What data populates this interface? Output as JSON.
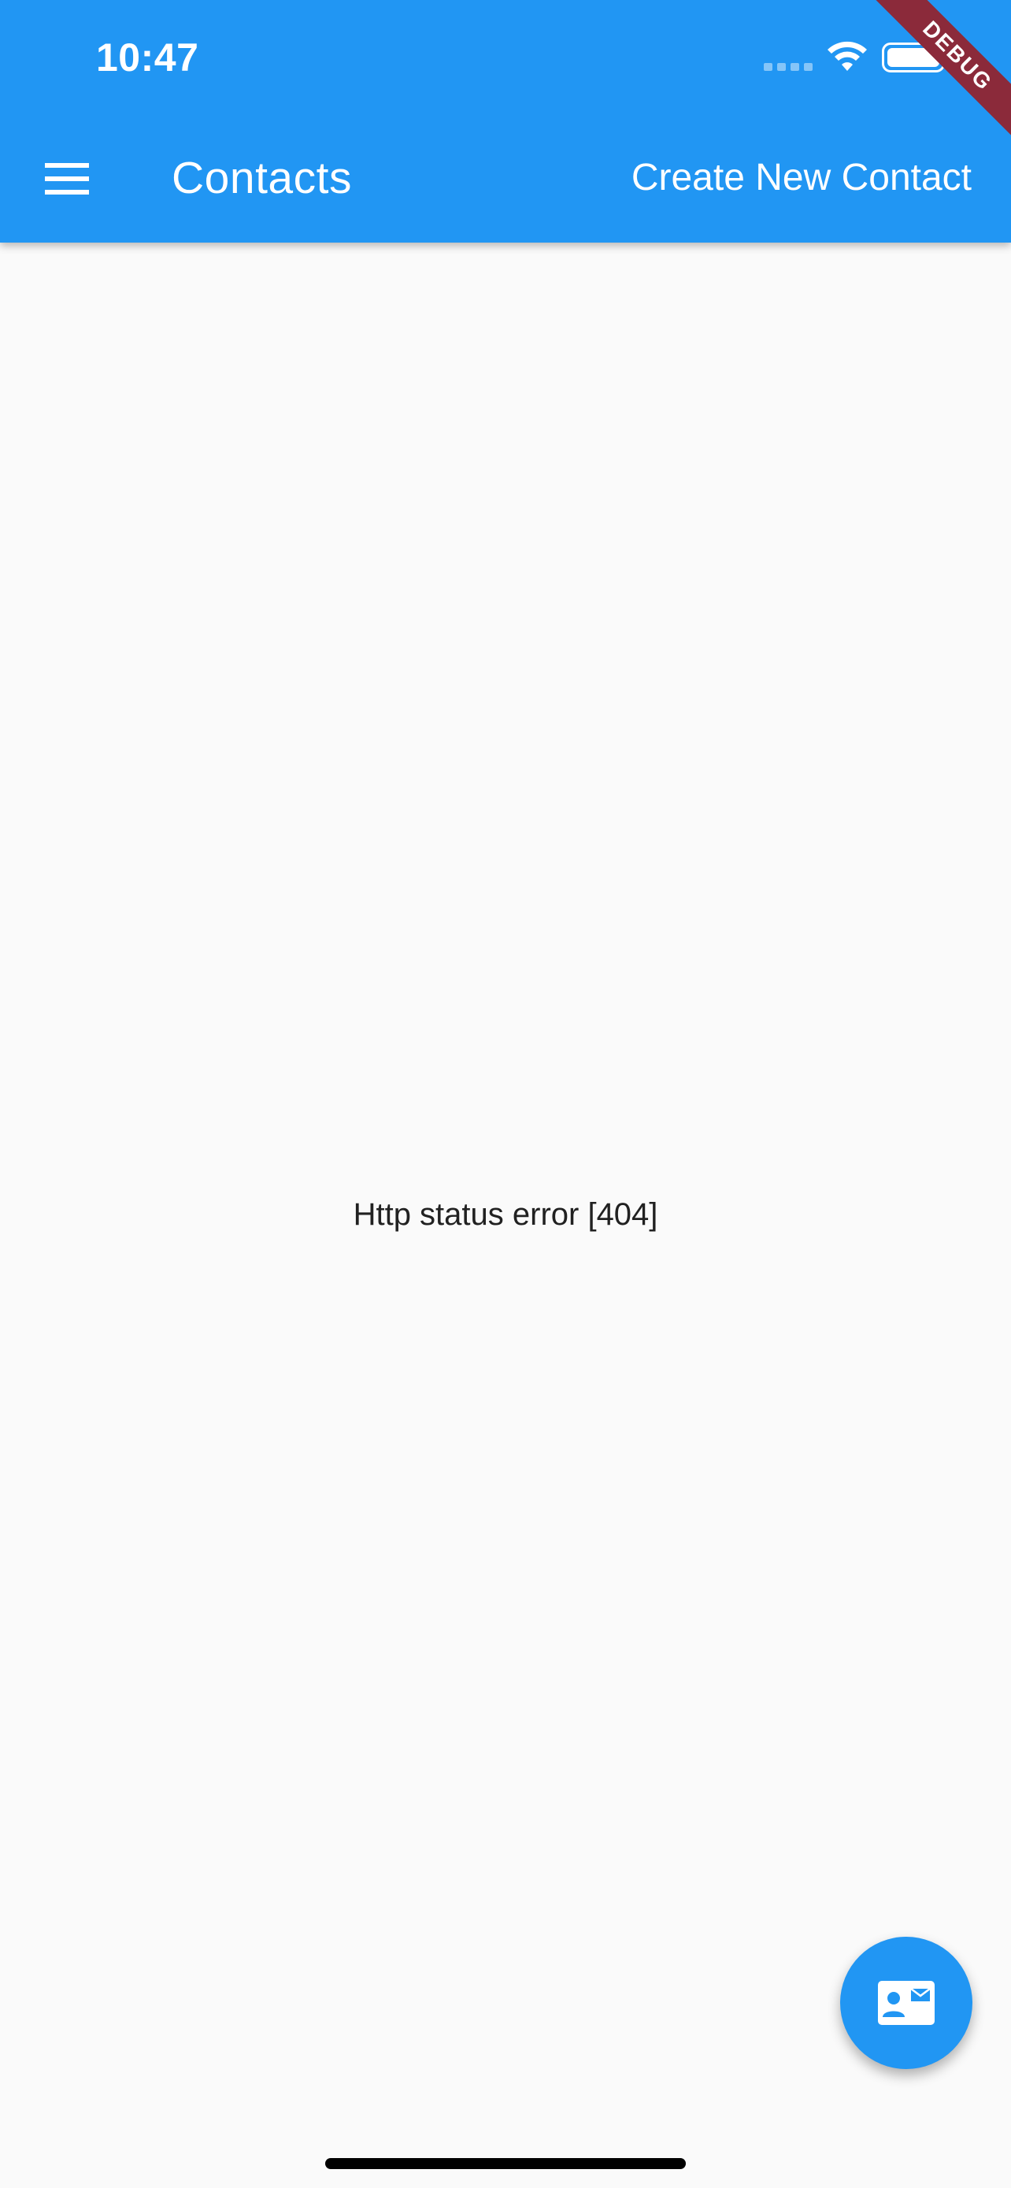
{
  "status_bar": {
    "time": "10:47",
    "wifi_icon": "wifi-icon",
    "battery_icon": "battery-full-icon"
  },
  "app_bar": {
    "menu_icon": "hamburger-menu-icon",
    "title": "Contacts",
    "action_label": "Create New Contact",
    "background_color": "#2196f3"
  },
  "debug_banner": {
    "label": "DEBUG",
    "color": "#8b2a3a"
  },
  "main": {
    "error_text": "Http status error [404]"
  },
  "fab": {
    "icon": "contact-mail-icon",
    "color": "#2196f3"
  }
}
